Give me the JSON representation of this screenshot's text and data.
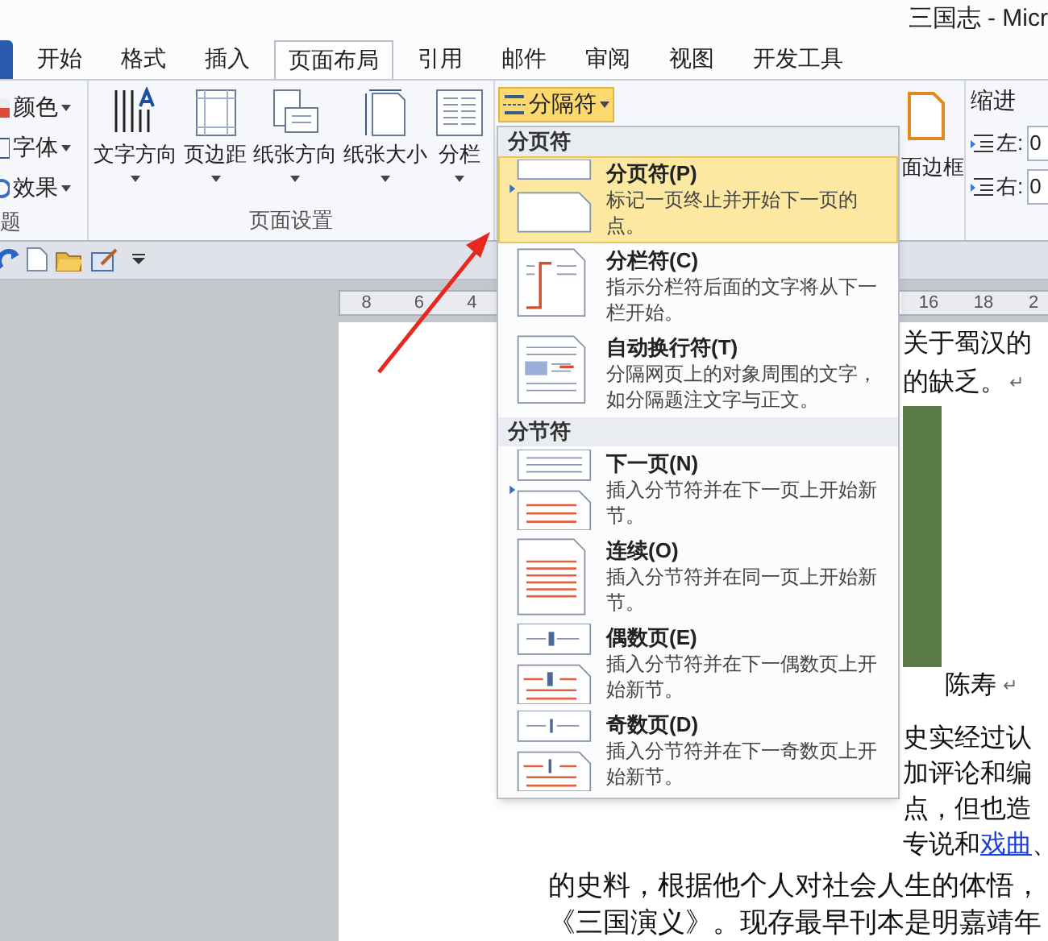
{
  "window": {
    "title": "三国志 - Micr"
  },
  "tabs": [
    {
      "label": "开始",
      "selected": false
    },
    {
      "label": "格式",
      "selected": false
    },
    {
      "label": "插入",
      "selected": false
    },
    {
      "label": "页面布局",
      "selected": true
    },
    {
      "label": "引用",
      "selected": false
    },
    {
      "label": "邮件",
      "selected": false
    },
    {
      "label": "审阅",
      "selected": false
    },
    {
      "label": "视图",
      "selected": false
    },
    {
      "label": "开发工具",
      "selected": false
    }
  ],
  "ribbon": {
    "theme_group": {
      "label": "题",
      "items": [
        {
          "label": "颜色",
          "kind": "colors"
        },
        {
          "label": "字体",
          "kind": "fonts"
        },
        {
          "label": "效果",
          "kind": "effects"
        }
      ]
    },
    "page_setup": {
      "label": "页面设置",
      "buttons": [
        {
          "label": "文字方向",
          "kind": "direction"
        },
        {
          "label": "页边距",
          "kind": "margins"
        },
        {
          "label": "纸张方向",
          "kind": "orientation"
        },
        {
          "label": "纸张大小",
          "kind": "size"
        },
        {
          "label": "分栏",
          "kind": "columns"
        }
      ],
      "breaks_button": {
        "label": "分隔符",
        "active": true
      }
    },
    "page_background": {
      "visible_label": "面边框"
    },
    "paragraph": {
      "label": "缩进",
      "fields": [
        {
          "label": "左:",
          "value": "0"
        },
        {
          "label": "右:",
          "value": "0"
        }
      ]
    }
  },
  "ruler": {
    "left_labels": [
      "8",
      "6",
      "4"
    ],
    "right_labels": [
      "16",
      "18",
      "2"
    ]
  },
  "breaks_menu": {
    "sections": [
      {
        "heading": "分页符",
        "items": [
          {
            "kind": "page",
            "title": "分页符(P)",
            "description": "标记一页终止并开始下一页的点。",
            "selected": true
          },
          {
            "kind": "column",
            "title": "分栏符(C)",
            "description": "指示分栏符后面的文字将从下一栏开始。",
            "selected": false
          },
          {
            "kind": "wrap",
            "title": "自动换行符(T)",
            "description": "分隔网页上的对象周围的文字，如分隔题注文字与正文。",
            "selected": false
          }
        ]
      },
      {
        "heading": "分节符",
        "items": [
          {
            "kind": "next",
            "title": "下一页(N)",
            "description": "插入分节符并在下一页上开始新节。",
            "selected": false
          },
          {
            "kind": "continuous",
            "title": "连续(O)",
            "description": "插入分节符并在同一页上开始新节。",
            "selected": false
          },
          {
            "kind": "even",
            "title": "偶数页(E)",
            "description": "插入分节符并在下一偶数页上开始新节。",
            "selected": false
          },
          {
            "kind": "odd",
            "title": "奇数页(D)",
            "description": "插入分节符并在下一奇数页上开始新节。",
            "selected": false
          }
        ]
      }
    ]
  },
  "document": {
    "top_lines": [
      {
        "segments": [
          {
            "text": "关于蜀汉的",
            "link": false
          }
        ]
      },
      {
        "segments": [
          {
            "text": "的缺乏。",
            "link": false
          }
        ],
        "mark": "↵"
      }
    ],
    "caption": {
      "text": "陈寿",
      "mark": "↵"
    },
    "side_lines": [
      {
        "segments": [
          {
            "text": "史实经过认",
            "link": false
          }
        ]
      },
      {
        "segments": [
          {
            "text": "加评论和编",
            "link": false
          }
        ]
      },
      {
        "segments": [
          {
            "text": "点，但也造",
            "link": false
          }
        ]
      },
      {
        "segments": [
          {
            "text": "专说和",
            "link": false
          },
          {
            "text": "戏曲",
            "link": true
          },
          {
            "text": "、",
            "link": false
          }
        ]
      }
    ],
    "full_lines": [
      {
        "segments": [
          {
            "text": "的史料，根据他个人对社会人生的体悟，",
            "link": false
          }
        ]
      },
      {
        "segments": [
          {
            "text": "《三国演义》。现存最早刊本是明嘉靖年",
            "link": false
          }
        ]
      }
    ]
  }
}
